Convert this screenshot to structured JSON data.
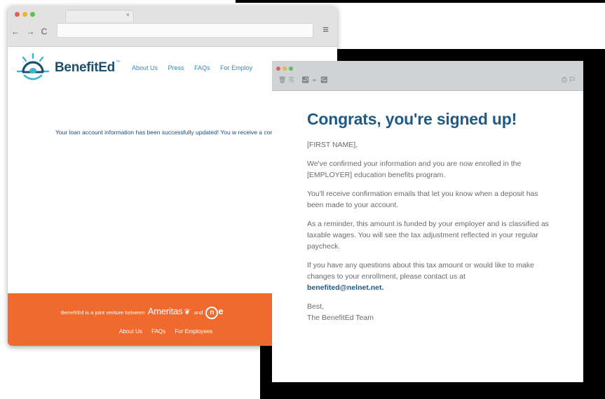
{
  "browser": {
    "tab_close": "×",
    "nav_icons": "← → C",
    "menu_icon": "≡"
  },
  "site": {
    "logo_text": "BenefitEd",
    "logo_tm": "™",
    "nav": [
      "About Us",
      "Press",
      "FAQs",
      "For Employ"
    ],
    "success_message": "Your loan account information has been successfully updated! You w receive a confirmation email shortly."
  },
  "footer": {
    "joint_prefix": "BenefitEd is a joint venture between",
    "ameritas": "Ameritas",
    "and": "and",
    "nelnet_letter": "n",
    "nelnet_tail": "e",
    "nav": [
      "About Us",
      "FAQs",
      "For Employees"
    ]
  },
  "email": {
    "title": "Congrats, you're signed up!",
    "greeting": "[FIRST NAME],",
    "p1": "We've confirmed your information and you are now enrolled in the [EMPLOYER] education benefits program.",
    "p2": "You'll receive confirmation emails that let you know when a deposit has been made to your account.",
    "p3": "As a reminder, this amount is funded by your employer and is classified as taxable wages. You will see the tax adjustment reflected in your regular paycheck.",
    "p4": "If you have any questions about this tax amount or would like to make changes to your enrollment, please contact us at",
    "contact_email": "benefited@nelnet.net.",
    "signoff": "Best,",
    "signature": "The BenefitEd Team"
  },
  "colors": {
    "brand_blue": "#1c4f6d",
    "link_blue": "#3a85b6",
    "footer_orange": "#f06a2d",
    "logo_teal": "#3bb5c9"
  }
}
